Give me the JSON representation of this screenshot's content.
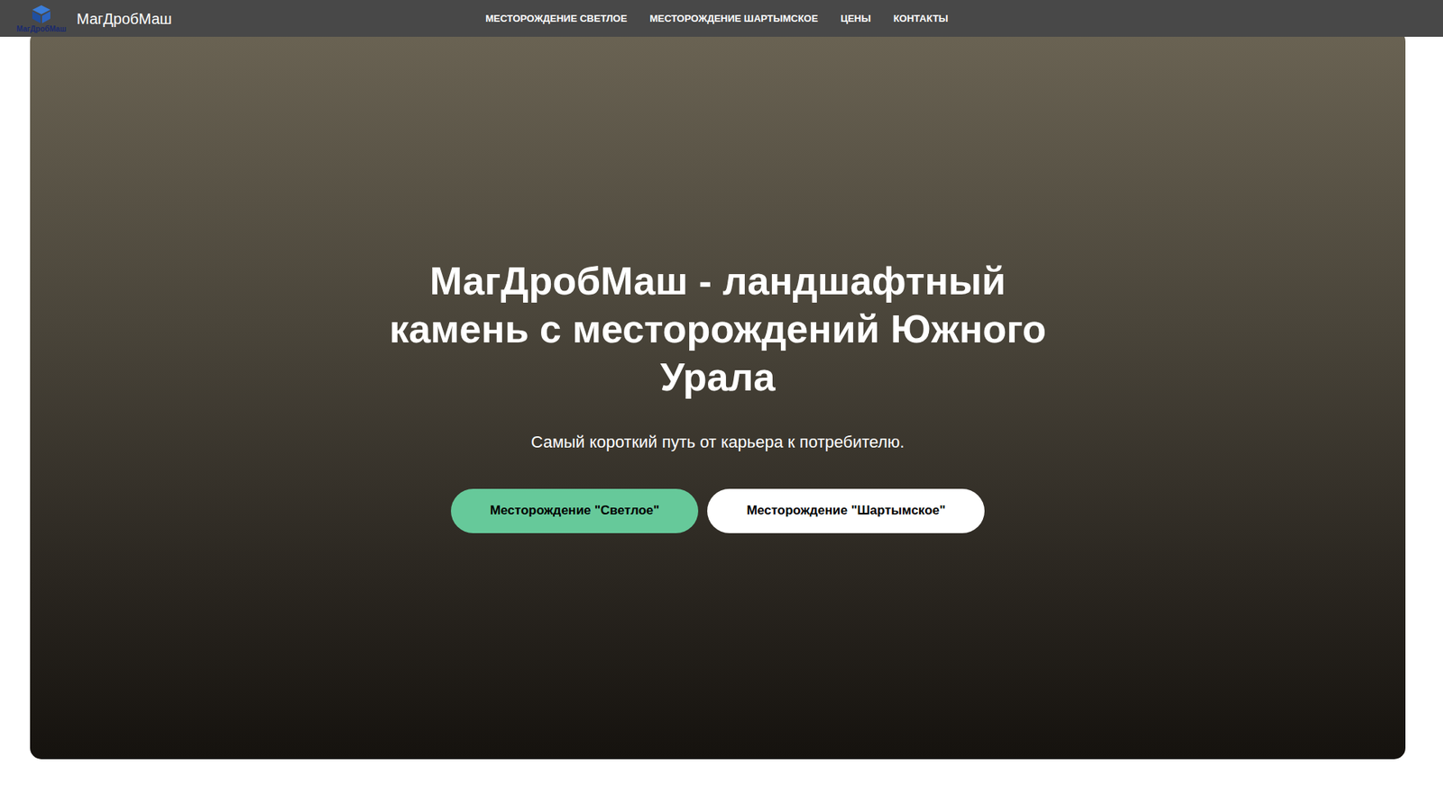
{
  "header": {
    "logo_caption": "МагДробМаш",
    "brand": "МагДробМаш",
    "nav": [
      {
        "label": "МЕСТОРОЖДЕНИЕ СВЕТЛОЕ"
      },
      {
        "label": "МЕСТОРОЖДЕНИЕ ШАРТЫМСКОЕ"
      },
      {
        "label": "ЦЕНЫ"
      },
      {
        "label": "КОНТАКТЫ"
      }
    ]
  },
  "hero": {
    "title": "МагДробМаш - ландшафтный камень с месторождений Южного Урала",
    "subtitle": "Самый короткий путь от карьера к потребителю.",
    "buttons": [
      {
        "label": "Месторождение \"Светлое\"",
        "kind": "primary"
      },
      {
        "label": "Месторождение \"Шартымское\"",
        "kind": "secondary"
      }
    ]
  }
}
